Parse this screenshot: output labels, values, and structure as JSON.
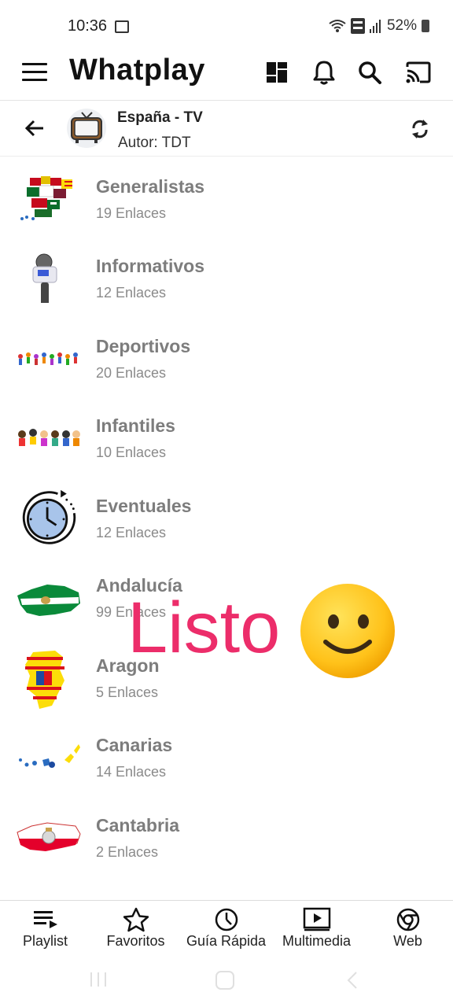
{
  "status_bar": {
    "time": "10:36",
    "battery": "52%",
    "network": "VoWiFi"
  },
  "app_bar": {
    "title": "Whatplay",
    "icons": [
      "menu-icon",
      "dashboard-icon",
      "bell-icon",
      "search-icon",
      "cast-icon"
    ]
  },
  "playlist": {
    "name": "España - TV",
    "author": "Autor: TDT"
  },
  "categories": [
    {
      "title": "Generalistas",
      "links": "19 Enlaces",
      "icon": "spain-regions-flags"
    },
    {
      "title": "Informativos",
      "links": "12 Enlaces",
      "icon": "microphone"
    },
    {
      "title": "Deportivos",
      "links": "20 Enlaces",
      "icon": "sports-figures"
    },
    {
      "title": "Infantiles",
      "links": "10 Enlaces",
      "icon": "children-figures"
    },
    {
      "title": "Eventuales",
      "links": "12 Enlaces",
      "icon": "clock"
    },
    {
      "title": "Andalucía",
      "links": "99 Enlaces",
      "icon": "andalucia-map"
    },
    {
      "title": "Aragon",
      "links": "5 Enlaces",
      "icon": "aragon-map"
    },
    {
      "title": "Canarias",
      "links": "14 Enlaces",
      "icon": "canarias-map"
    },
    {
      "title": "Cantabria",
      "links": "2 Enlaces",
      "icon": "cantabria-map"
    }
  ],
  "overlay": {
    "text": "Listo",
    "emoji": "slightly-smiling-face",
    "text_color": "#ec2d6a"
  },
  "bottom_nav": [
    {
      "label": "Playlist",
      "icon": "playlist-icon"
    },
    {
      "label": "Favoritos",
      "icon": "star-icon"
    },
    {
      "label": "Guía Rápida",
      "icon": "clock-icon"
    },
    {
      "label": "Multimedia",
      "icon": "video-icon"
    },
    {
      "label": "Web",
      "icon": "chrome-icon"
    }
  ]
}
